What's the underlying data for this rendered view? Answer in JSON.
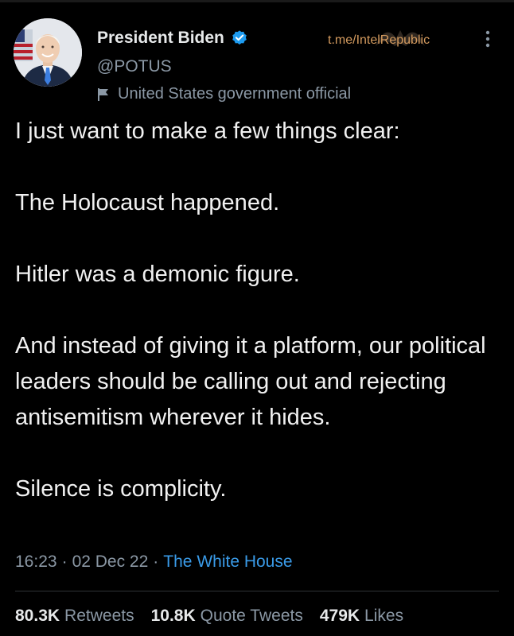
{
  "author": {
    "display_name": "President Biden",
    "handle": "@POTUS",
    "label": "United States government official",
    "avatar_icon": "profile-photo",
    "verified_icon": "verified-badge-icon",
    "verified_color": "#1d9bf0"
  },
  "watermark": {
    "text": "t.me/IntelRepublic"
  },
  "tweet": {
    "lines": [
      "I just want to make a few things clear:",
      "The Holocaust happened.",
      "Hitler was a demonic figure.",
      "And instead of giving it a platform, our political leaders should be calling out and rejecting antisemitism wherever it hides.",
      "Silence is complicity."
    ]
  },
  "meta": {
    "time": "16:23",
    "date": "02 Dec 22",
    "source": "The White House",
    "source_color": "#3a9be8"
  },
  "stats": [
    {
      "count": "80.3K",
      "label": "Retweets"
    },
    {
      "count": "10.8K",
      "label": "Quote Tweets"
    },
    {
      "count": "479K",
      "label": "Likes"
    }
  ],
  "colors": {
    "background": "#000000",
    "text": "#e7e9ea",
    "secondary": "#8b98a5",
    "watermark": "#d39a5e"
  }
}
